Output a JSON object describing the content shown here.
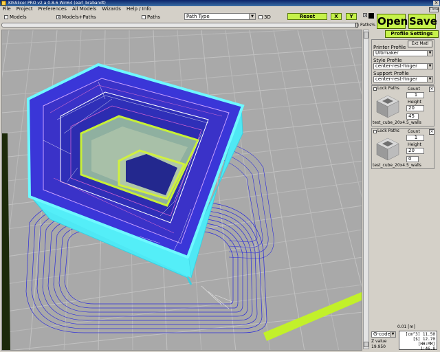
{
  "window": {
    "title": "KISSlicer PRO v2 a 0.8.6 Win64 (earl_brabandt)",
    "close_label": "Close"
  },
  "menu": [
    "File",
    "Project",
    "Preferences",
    "All Models",
    "Wizards",
    "Help / Info"
  ],
  "toolbar": {
    "models": {
      "label": "Models",
      "checked": false
    },
    "models_paths": {
      "label": "Models+Paths",
      "checked": true
    },
    "paths": {
      "label": "Paths",
      "checked": false
    },
    "path_type": "Path Type",
    "three_d": {
      "label": "3D",
      "checked": false
    },
    "reset": "Reset",
    "x": "X",
    "y": "Y",
    "paths_pct": "Paths%"
  },
  "actions": {
    "open": "Open",
    "save": "Save"
  },
  "side": {
    "profile_settings": "Profile Settings",
    "ext_matl": "Ext Matl",
    "printer_profile_label": "Printer Profile",
    "printer_profile": "Ultimaker",
    "style_profile_label": "Style Profile",
    "style_profile": "center-rest-finger",
    "support_profile_label": "Support Profile",
    "support_profile": "center-rest-finger",
    "models": [
      {
        "lock": "Lock Paths",
        "count_label": "Count",
        "count": "1",
        "height_label": "Height",
        "height": "20",
        "angle": "45",
        "name": "test_cube_20x4.5_walls"
      },
      {
        "lock": "Lock Paths",
        "count_label": "Count",
        "count": "1",
        "height_label": "Height",
        "height": "20",
        "angle": "0",
        "name": "test_cube_20x4.5_walls"
      }
    ],
    "zoom_value": "0.01 [m]",
    "gcode_label": "G-code",
    "z_label": "Z value",
    "z_value": "19.950",
    "stats": [
      "[cm^3]  11.50",
      "[$]  12.70",
      "[HH:MM]  1:46.8"
    ]
  },
  "colors": {
    "accent_green": "#c6f24a",
    "viewport_bg": "#a8a8a8",
    "cube_cyan": "#5ff6ff",
    "cube_lime": "#c8f036"
  }
}
